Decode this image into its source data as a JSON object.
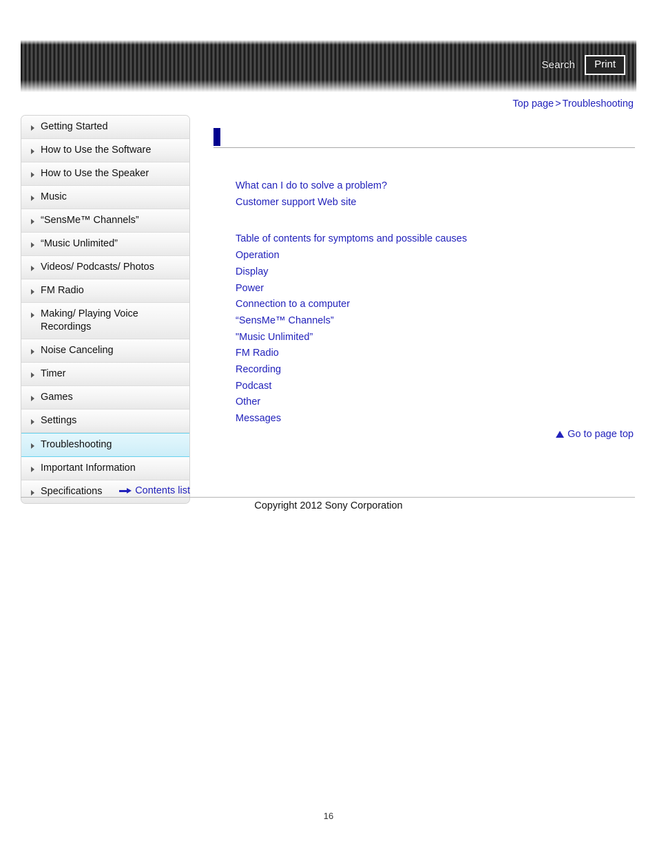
{
  "header": {
    "search_label": "Search",
    "print_label": "Print"
  },
  "breadcrumb": {
    "top_page": "Top page",
    "separator": ">",
    "current": "Troubleshooting"
  },
  "sidebar": {
    "items": [
      {
        "label": "Getting Started",
        "active": false
      },
      {
        "label": "How to Use the Software",
        "active": false
      },
      {
        "label": "How to Use the Speaker",
        "active": false
      },
      {
        "label": "Music",
        "active": false
      },
      {
        "label": "“SensMe™ Channels”",
        "active": false
      },
      {
        "label": "“Music Unlimited”",
        "active": false
      },
      {
        "label": "Videos/ Podcasts/ Photos",
        "active": false
      },
      {
        "label": "FM Radio",
        "active": false
      },
      {
        "label": "Making/ Playing Voice Recordings",
        "active": false
      },
      {
        "label": "Noise Canceling",
        "active": false
      },
      {
        "label": "Timer",
        "active": false
      },
      {
        "label": "Games",
        "active": false
      },
      {
        "label": "Settings",
        "active": false
      },
      {
        "label": "Troubleshooting",
        "active": true
      },
      {
        "label": "Important Information",
        "active": false
      },
      {
        "label": "Specifications",
        "active": false
      }
    ],
    "contents_list_label": "Contents list"
  },
  "main": {
    "page_title": "",
    "primary_links": [
      "What can I do to solve a problem?",
      "Customer support Web site"
    ],
    "secondary_links": [
      "Table of contents for symptoms and possible causes",
      "Operation",
      "Display",
      "Power",
      "Connection to a computer",
      "“SensMe™ Channels”",
      "\"Music Unlimited”",
      "FM Radio",
      "Recording",
      "Podcast",
      "Other",
      "Messages"
    ],
    "go_to_page_top_label": "Go to page top"
  },
  "footer": {
    "copyright": "Copyright 2012 Sony Corporation",
    "page_number": "16"
  }
}
